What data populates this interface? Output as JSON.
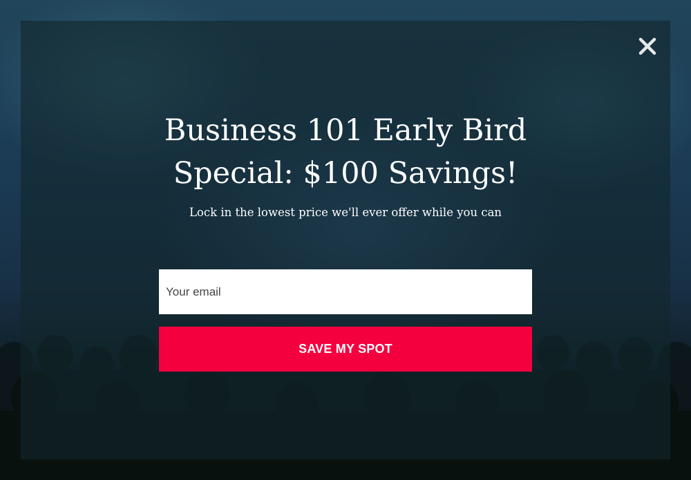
{
  "popup": {
    "headline": "Business 101 Early Bird Special: $100 Savings!",
    "subheadline": "Lock in the lowest price we'll ever offer while you can",
    "email_placeholder": "Your email",
    "email_value": "",
    "cta_label": "SAVE MY SPOT",
    "close_icon": "close-icon"
  },
  "colors": {
    "cta_background": "#f5003f",
    "text": "#ffffff",
    "input_background": "#ffffff"
  }
}
